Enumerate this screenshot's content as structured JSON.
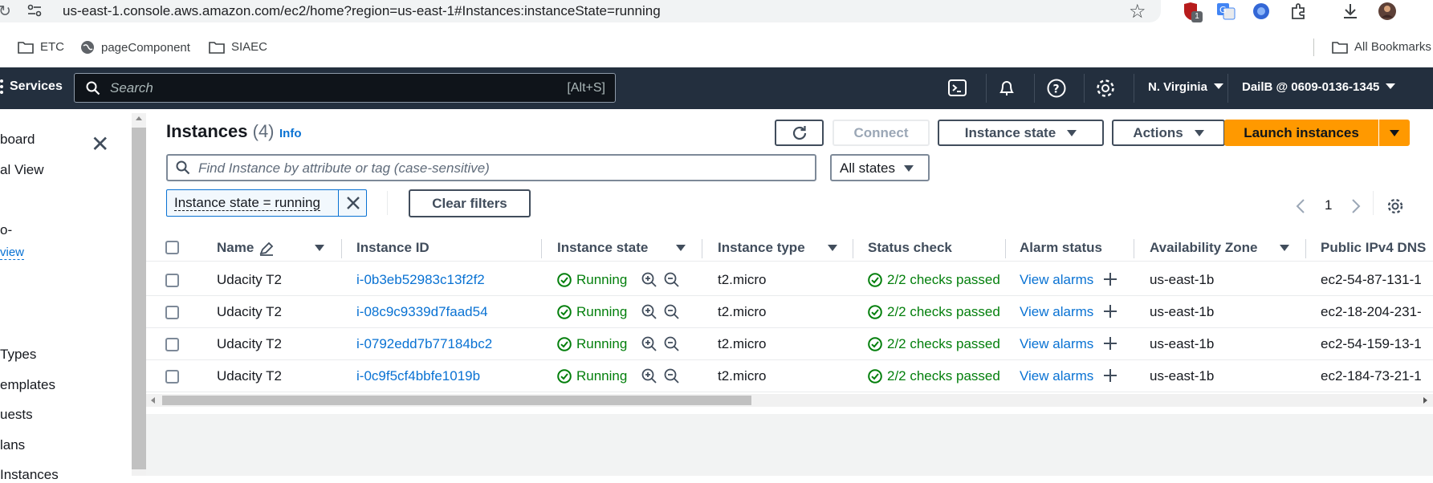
{
  "browser": {
    "url": "us-east-1.console.aws.amazon.com/ec2/home?region=us-east-1#Instances:instanceState=running",
    "extension_badge": "1",
    "bookmarks": [
      "ETC",
      "pageComponent",
      "SIAEC"
    ],
    "all_bookmarks": "All Bookmarks"
  },
  "topnav": {
    "services": "Services",
    "search_placeholder": "Search",
    "search_shortcut": "[Alt+S]",
    "region": "N. Virginia",
    "account": "DailB @ 0609-0136-1345"
  },
  "sidenav": {
    "items": [
      "board",
      "al View",
      "o-",
      "view",
      "Types",
      "emplates",
      "uests",
      "lans",
      "Instances"
    ]
  },
  "page": {
    "title": "Instances",
    "count": "(4)",
    "info": "Info",
    "connect": "Connect",
    "instance_state": "Instance state",
    "actions": "Actions",
    "launch": "Launch instances",
    "find_placeholder": "Find Instance by attribute or tag (case-sensitive)",
    "states_select": "All states",
    "filter_token": "Instance state = running",
    "clear_filters": "Clear filters",
    "page_number": "1"
  },
  "table": {
    "columns": [
      "Name",
      "Instance ID",
      "Instance state",
      "Instance type",
      "Status check",
      "Alarm status",
      "Availability Zone",
      "Public IPv4 DNS"
    ],
    "rows": [
      {
        "name": "Udacity T2",
        "id": "i-0b3eb52983c13f2f2",
        "state": "Running",
        "type": "t2.micro",
        "status": "2/2 checks passed",
        "alarm": "View alarms",
        "az": "us-east-1b",
        "dns": "ec2-54-87-131-1"
      },
      {
        "name": "Udacity T2",
        "id": "i-08c9c9339d7faad54",
        "state": "Running",
        "type": "t2.micro",
        "status": "2/2 checks passed",
        "alarm": "View alarms",
        "az": "us-east-1b",
        "dns": "ec2-18-204-231-"
      },
      {
        "name": "Udacity T2",
        "id": "i-0792edd7b77184bc2",
        "state": "Running",
        "type": "t2.micro",
        "status": "2/2 checks passed",
        "alarm": "View alarms",
        "az": "us-east-1b",
        "dns": "ec2-54-159-13-1"
      },
      {
        "name": "Udacity T2",
        "id": "i-0c9f5cf4bbfe1019b",
        "state": "Running",
        "type": "t2.micro",
        "status": "2/2 checks passed",
        "alarm": "View alarms",
        "az": "us-east-1b",
        "dns": "ec2-184-73-21-1"
      }
    ]
  },
  "colors": {
    "aws_nav": "#232f3e",
    "primary": "#ff9900",
    "link": "#0972d3",
    "success": "#037f0c"
  }
}
